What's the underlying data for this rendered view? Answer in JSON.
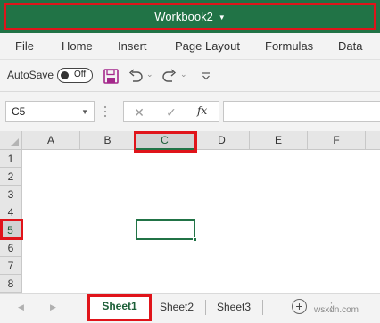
{
  "window": {
    "title": "Workbook2",
    "highlight_color": "#e0141a",
    "brand_color": "#217346"
  },
  "menu": {
    "items": [
      "File",
      "Home",
      "Insert",
      "Page Layout",
      "Formulas",
      "Data"
    ]
  },
  "quick_access": {
    "autosave_label": "AutoSave",
    "autosave_state": "Off",
    "icons": [
      "save-icon",
      "undo-icon",
      "redo-icon",
      "customize-toolbar-icon"
    ]
  },
  "formula_bar": {
    "name_box": "C5",
    "fx_label": "fx",
    "formula_value": ""
  },
  "grid": {
    "columns": [
      "A",
      "B",
      "C",
      "D",
      "E",
      "F"
    ],
    "rows": [
      "1",
      "2",
      "3",
      "4",
      "5",
      "6",
      "7",
      "8"
    ],
    "selected_column": "C",
    "selected_row": "5",
    "active_cell": "C5"
  },
  "sheets": {
    "tabs": [
      "Sheet1",
      "Sheet2",
      "Sheet3"
    ],
    "active": "Sheet1"
  },
  "watermark": "wsxdn.com"
}
